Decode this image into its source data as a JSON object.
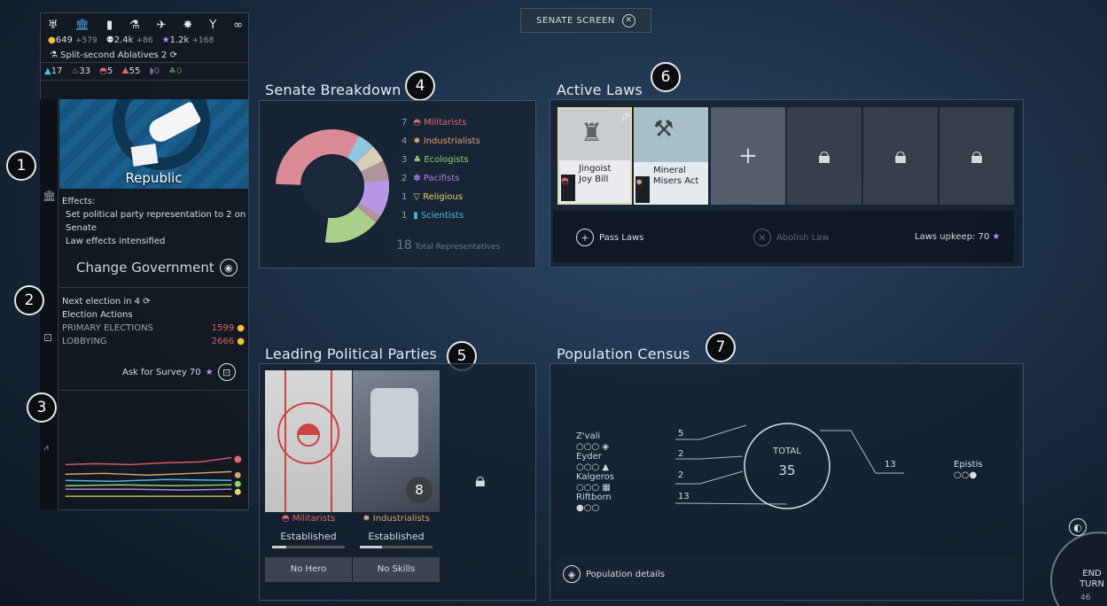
{
  "top": {
    "screen_title": "SENATE SCREEN"
  },
  "left": {
    "resources": {
      "dust": "649",
      "dust_delta": "+579",
      "pop": "2.4k",
      "pop_delta": "+86",
      "influence": "1.2k",
      "influence_delta": "+168"
    },
    "tech": "Split-second Ablatives 2",
    "stats": [
      "17",
      "33",
      "5",
      "55",
      "0",
      "0"
    ],
    "government": "Republic",
    "effects_title": "Effects:",
    "effect_1": "Set political party representation to 2 on Senate",
    "effect_2": "Law effects intensified",
    "change_gov": "Change Government",
    "next_election": "Next election in 4",
    "election_actions": "Election Actions",
    "primary": "PRIMARY ELECTIONS",
    "primary_cost": "1599",
    "lobbying": "LOBBYING",
    "lobbying_cost": "2666",
    "survey": "Ask for Survey 70"
  },
  "badges": [
    "1",
    "2",
    "3",
    "4",
    "5",
    "6",
    "7"
  ],
  "breakdown": {
    "title": "Senate Breakdown",
    "legend": [
      {
        "n": "7",
        "name": "Militarists",
        "color": "#e06a6a"
      },
      {
        "n": "4",
        "name": "Industrialists",
        "color": "#e0a26a"
      },
      {
        "n": "3",
        "name": "Ecologists",
        "color": "#8ed46a"
      },
      {
        "n": "2",
        "name": "Pacifists",
        "color": "#b07ee0"
      },
      {
        "n": "1",
        "name": "Religious",
        "color": "#e6d06a"
      },
      {
        "n": "1",
        "name": "Scientists",
        "color": "#4fb8e0"
      }
    ],
    "total_num": "18",
    "total_label": "Total Representatives"
  },
  "laws": {
    "title": "Active Laws",
    "law_1": "Jingoist Joy Bill",
    "law_2": "Mineral Misers Act",
    "add": "+",
    "pass": "Pass Laws",
    "abolish": "Abolish Law",
    "upkeep": "Laws upkeep: 70"
  },
  "parties": {
    "title": "Leading Political Parties",
    "p1_name": "Militarists",
    "p1_status": "Established",
    "p1_footer": "No Hero",
    "p2_name": "Industrialists",
    "p2_status": "Established",
    "p2_footer": "No Skills",
    "p2_level": "8"
  },
  "census": {
    "title": "Population Census",
    "races": [
      "Z'vali",
      "Eyder",
      "Kalgeros",
      "Riftborn"
    ],
    "left_values": [
      "5",
      "2",
      "2",
      "13"
    ],
    "total_label": "TOTAL",
    "total": "35",
    "right_value": "13",
    "right_race": "Epistis",
    "details": "Population details"
  },
  "end_turn": {
    "label": "END TURN",
    "turns": "46"
  },
  "colors": {
    "militarists": "#e06a6a",
    "influence": "#b98cff",
    "dust": "#f2c23a"
  }
}
